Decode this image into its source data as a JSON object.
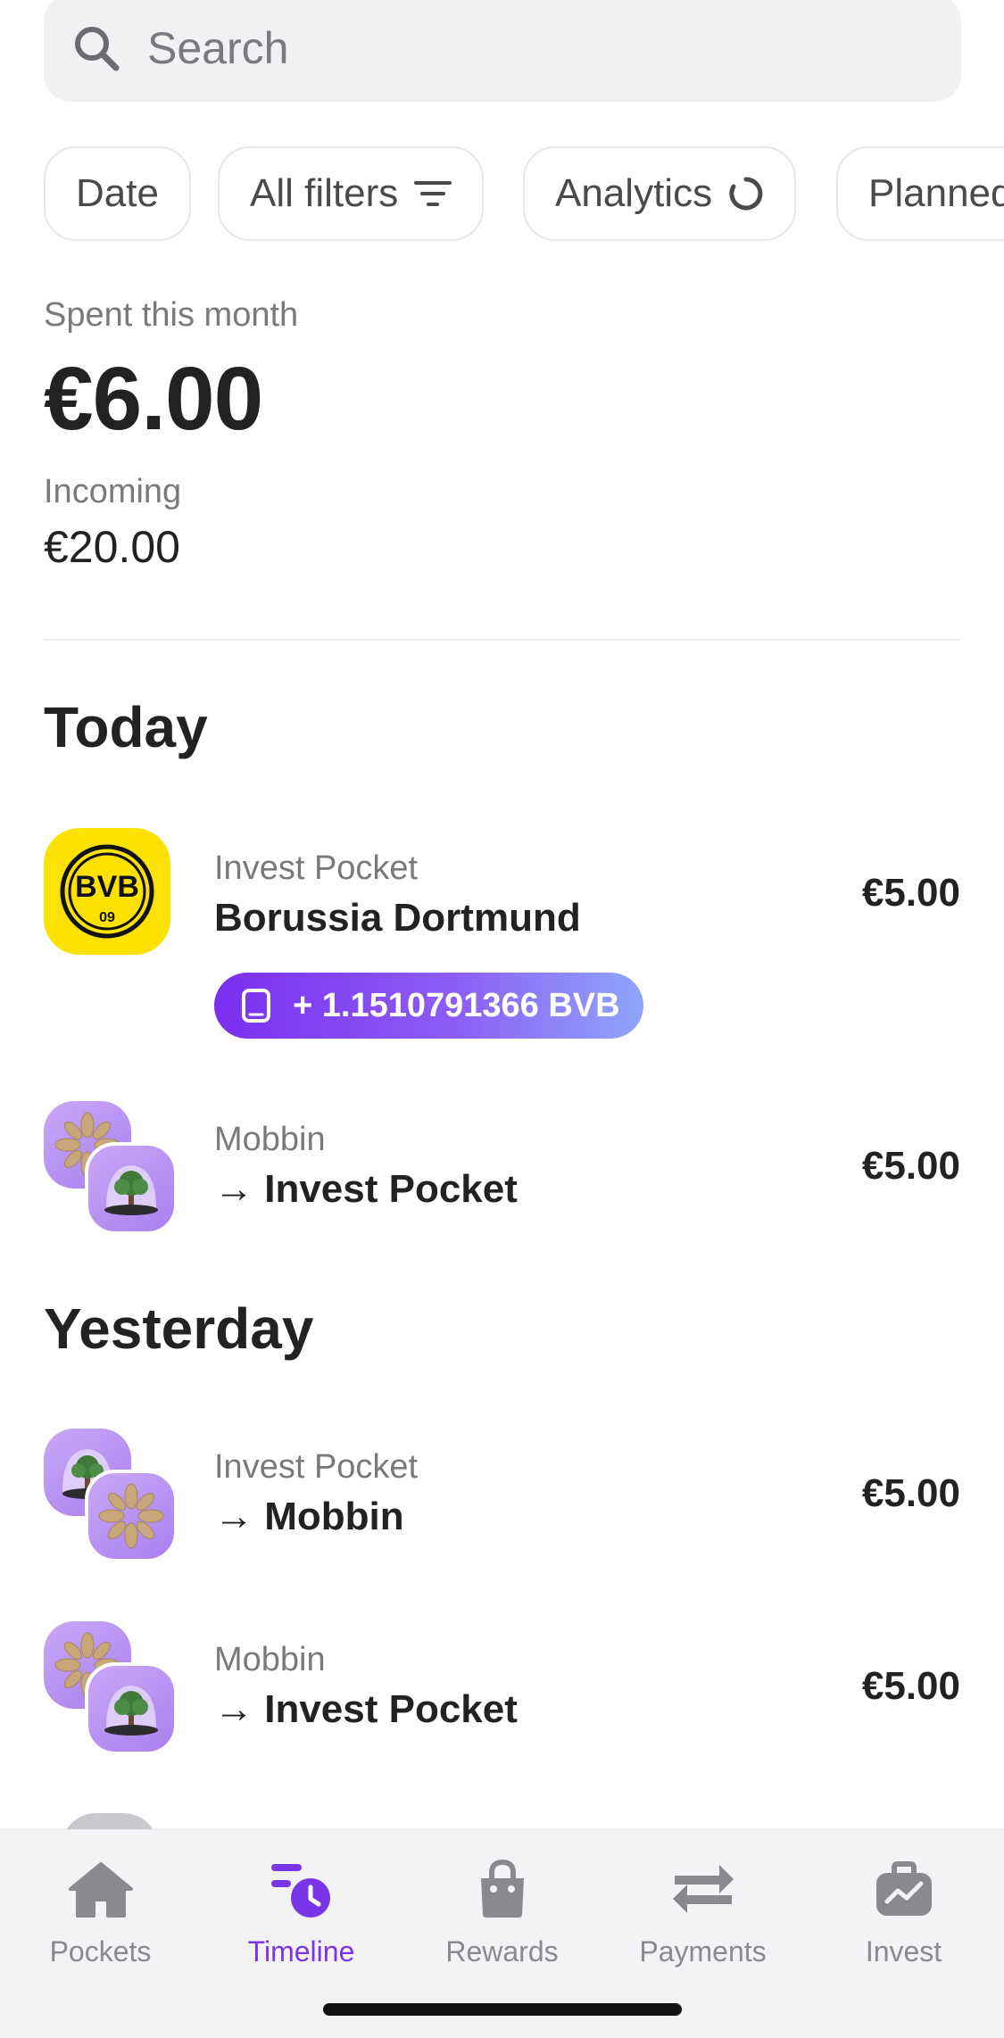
{
  "search": {
    "placeholder": "Search"
  },
  "filters": [
    {
      "label": "Date"
    },
    {
      "label": "All filters"
    },
    {
      "label": "Analytics"
    },
    {
      "label": "Planned"
    }
  ],
  "summary": {
    "spent_label": "Spent this month",
    "spent_amount": "€6.00",
    "incoming_label": "Incoming",
    "incoming_amount": "€20.00"
  },
  "sections": {
    "today": "Today",
    "yesterday": "Yesterday"
  },
  "transactions": [
    {
      "sub": "Invest Pocket",
      "title": "Borussia Dortmund",
      "amount": "€5.00",
      "logo_text": "BVB",
      "logo_sub": "09",
      "badge": "+ 1.1510791366 BVB"
    },
    {
      "sub": "Mobbin",
      "title": "→ Invest Pocket",
      "amount": "€5.00"
    },
    {
      "sub": "Invest Pocket",
      "title": "→ Mobbin",
      "amount": "€5.00"
    },
    {
      "sub": "Mobbin",
      "title": "→ Invest Pocket",
      "amount": "€5.00"
    }
  ],
  "nav": [
    {
      "label": "Pockets",
      "icon": "home-icon"
    },
    {
      "label": "Timeline",
      "icon": "timeline-icon",
      "active": true
    },
    {
      "label": "Rewards",
      "icon": "bag-icon"
    },
    {
      "label": "Payments",
      "icon": "transfer-arrows-icon"
    },
    {
      "label": "Invest",
      "icon": "briefcase-chart-icon"
    }
  ],
  "colors": {
    "accent": "#7b35e8",
    "bvb_yellow": "#fde100",
    "badge_gradient_start": "#7b2ff0",
    "badge_gradient_end": "#8fa6fa"
  }
}
